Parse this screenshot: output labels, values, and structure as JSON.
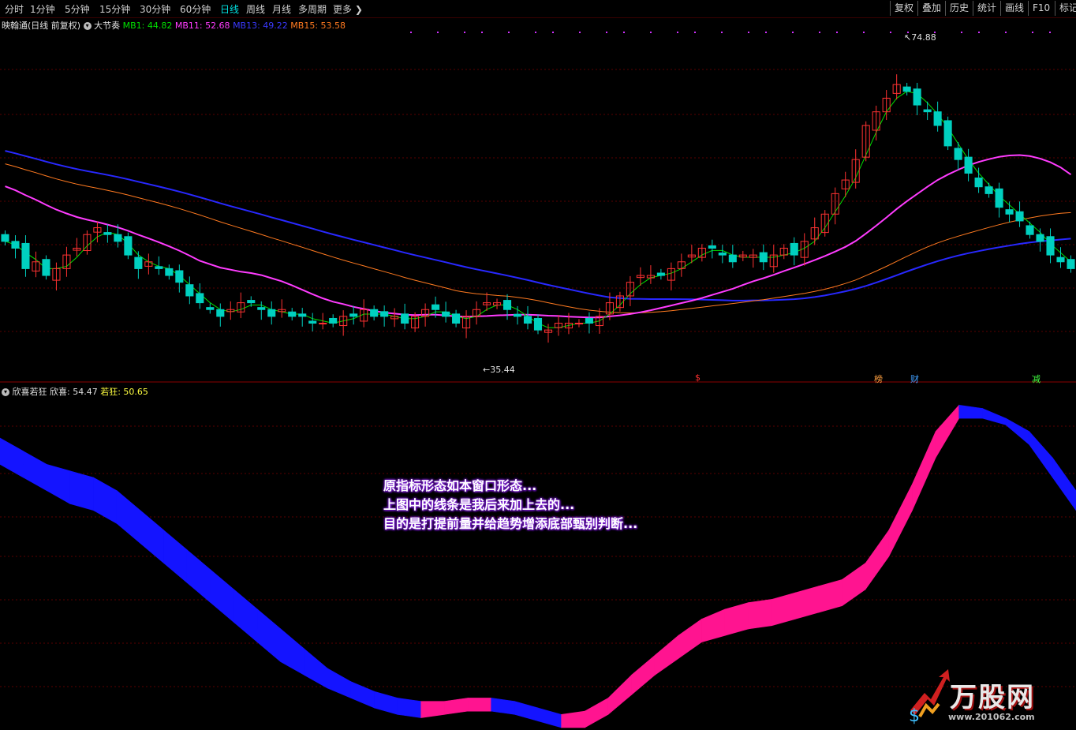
{
  "toolbar": {
    "periods": [
      "分时",
      "1分钟",
      "5分钟",
      "15分钟",
      "30分钟",
      "60分钟",
      "日线",
      "周线",
      "月线",
      "多周期",
      "更多"
    ],
    "active_period": "日线",
    "right_buttons": [
      "复权",
      "叠加",
      "历史",
      "统计",
      "画线",
      "F10",
      "标记"
    ]
  },
  "main_header": {
    "stock": "映翰通",
    "mode": "(日线 前复权)",
    "indicator": "大节奏",
    "ma": [
      {
        "label": "MB1: 44.82",
        "color": "#00e000"
      },
      {
        "label": "MB11: 52.68",
        "color": "#ff3cff"
      },
      {
        "label": "MB13: 49.22",
        "color": "#2a2aff"
      },
      {
        "label": "MB15: 53.58",
        "color": "#ff7a20"
      }
    ]
  },
  "sub_header": {
    "indicator": "欣喜若狂",
    "items": [
      {
        "label": "欣喜: 54.47",
        "color": "#e0e0e0"
      },
      {
        "label": "若狂: 50.65",
        "color": "#ffff40"
      }
    ]
  },
  "event_markers": [
    {
      "text": "$",
      "color": "#ff3030"
    },
    {
      "text": "榜",
      "color": "#ffa040"
    },
    {
      "text": "财",
      "color": "#40a0ff"
    },
    {
      "text": "减",
      "color": "#40ff40"
    }
  ],
  "annotation_lines": [
    "原指标形态如本窗口形态...",
    "上图中的线条是我后来加上去的...",
    "目的是打提前量并给趋势增添底部甄别判断..."
  ],
  "watermark": {
    "text": "万股网",
    "url": "www.201062.com"
  },
  "chart_data": [
    {
      "type": "candlestick",
      "title": "映翰通 (日线 前复权)",
      "high_label": "74.88",
      "low_label": "35.44",
      "colors": {
        "up": "#ff3232",
        "down": "#00d0c0"
      },
      "ylim": [
        30,
        80
      ],
      "closes": [
        49,
        48,
        45,
        46,
        44,
        45,
        47,
        48,
        50,
        51,
        50,
        49,
        47,
        45,
        46,
        45,
        44,
        43,
        41,
        40,
        39,
        38,
        39,
        40,
        40,
        39,
        38,
        39,
        38,
        38,
        37,
        37,
        37,
        38,
        38,
        39,
        38,
        38,
        38,
        37,
        38,
        39,
        39,
        38,
        37,
        38,
        39,
        40,
        40,
        39,
        38,
        37,
        36,
        36,
        37,
        37,
        37,
        37,
        38,
        40,
        41,
        43,
        44,
        44,
        44,
        45,
        46,
        47,
        48,
        48,
        47,
        46,
        47,
        47,
        46,
        47,
        48,
        47,
        49,
        51,
        53,
        56,
        58,
        61,
        66,
        68,
        70,
        72,
        71,
        69,
        68,
        66,
        63,
        61,
        59,
        57,
        56,
        54,
        53,
        52,
        50,
        49,
        47,
        46,
        45
      ]
    },
    {
      "type": "area-band",
      "title": "欣喜若狂",
      "series": [
        {
          "name": "欣喜",
          "value": 54.47
        },
        {
          "name": "若狂",
          "value": 50.65
        }
      ],
      "colors": {
        "rising": "#ff1490",
        "falling": "#1414ff"
      },
      "ylim": [
        0,
        100
      ],
      "upper": [
        88,
        84,
        80,
        78,
        76,
        72,
        66,
        60,
        54,
        48,
        42,
        36,
        30,
        24,
        18,
        14,
        11,
        9,
        8,
        8,
        9,
        9,
        8,
        6,
        4,
        5,
        9,
        16,
        22,
        28,
        33,
        36,
        38,
        39,
        41,
        43,
        45,
        50,
        60,
        74,
        90,
        98,
        97,
        94,
        90,
        82,
        72
      ],
      "lower": [
        80,
        76,
        72,
        68,
        66,
        62,
        56,
        50,
        44,
        38,
        32,
        26,
        20,
        16,
        12,
        9,
        6,
        4,
        3,
        4,
        5,
        5,
        4,
        2,
        0,
        0,
        4,
        10,
        16,
        21,
        26,
        28,
        30,
        31,
        33,
        35,
        37,
        42,
        52,
        66,
        82,
        94,
        94,
        92,
        86,
        76,
        66
      ]
    }
  ]
}
